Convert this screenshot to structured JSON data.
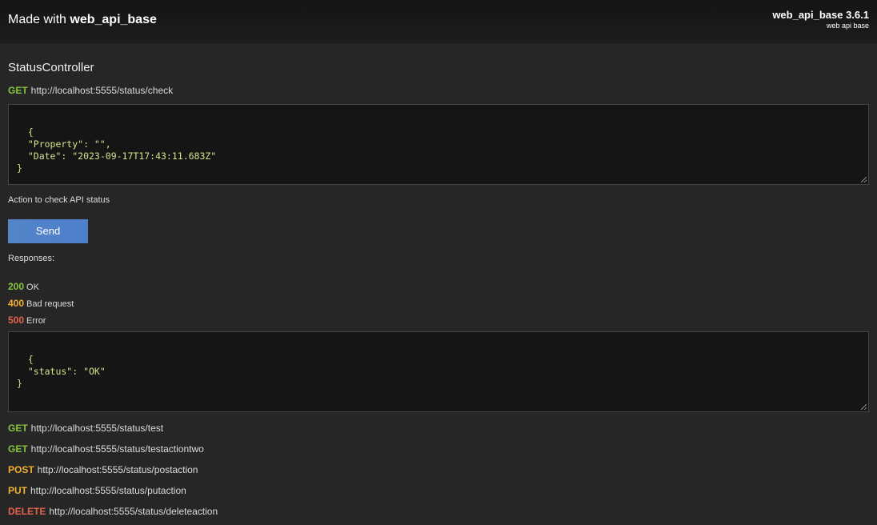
{
  "header": {
    "title_prefix": "Made with ",
    "title_name": "web_api_base",
    "version": "web_api_base 3.6.1",
    "subtitle": "web api base"
  },
  "controller": {
    "name": "StatusController"
  },
  "main_endpoint": {
    "method": "GET",
    "url": "http://localhost:5555/status/check",
    "request_body": "{\n  \"Property\": \"\",\n  \"Date\": \"2023-09-17T17:43:11.683Z\"\n}",
    "description": "Action to check API status",
    "send_label": "Send",
    "responses_label": "Responses:",
    "responses": [
      {
        "code": "200",
        "text": "OK"
      },
      {
        "code": "400",
        "text": "Bad request"
      },
      {
        "code": "500",
        "text": "Error"
      }
    ],
    "response_body": "{\n  \"status\": \"OK\"\n}"
  },
  "other_endpoints": [
    {
      "method": "GET",
      "url": "http://localhost:5555/status/test"
    },
    {
      "method": "GET",
      "url": "http://localhost:5555/status/testactiontwo"
    },
    {
      "method": "POST",
      "url": "http://localhost:5555/status/postaction"
    },
    {
      "method": "PUT",
      "url": "http://localhost:5555/status/putaction"
    },
    {
      "method": "DELETE",
      "url": "http://localhost:5555/status/deleteaction"
    }
  ],
  "colors": {
    "get": "#86c440",
    "post": "#f0b132",
    "put": "#f0b132",
    "delete": "#e5624a",
    "code_200": "#86c440",
    "code_400": "#f0b132",
    "code_500": "#e5624a",
    "button": "#5485c9"
  }
}
